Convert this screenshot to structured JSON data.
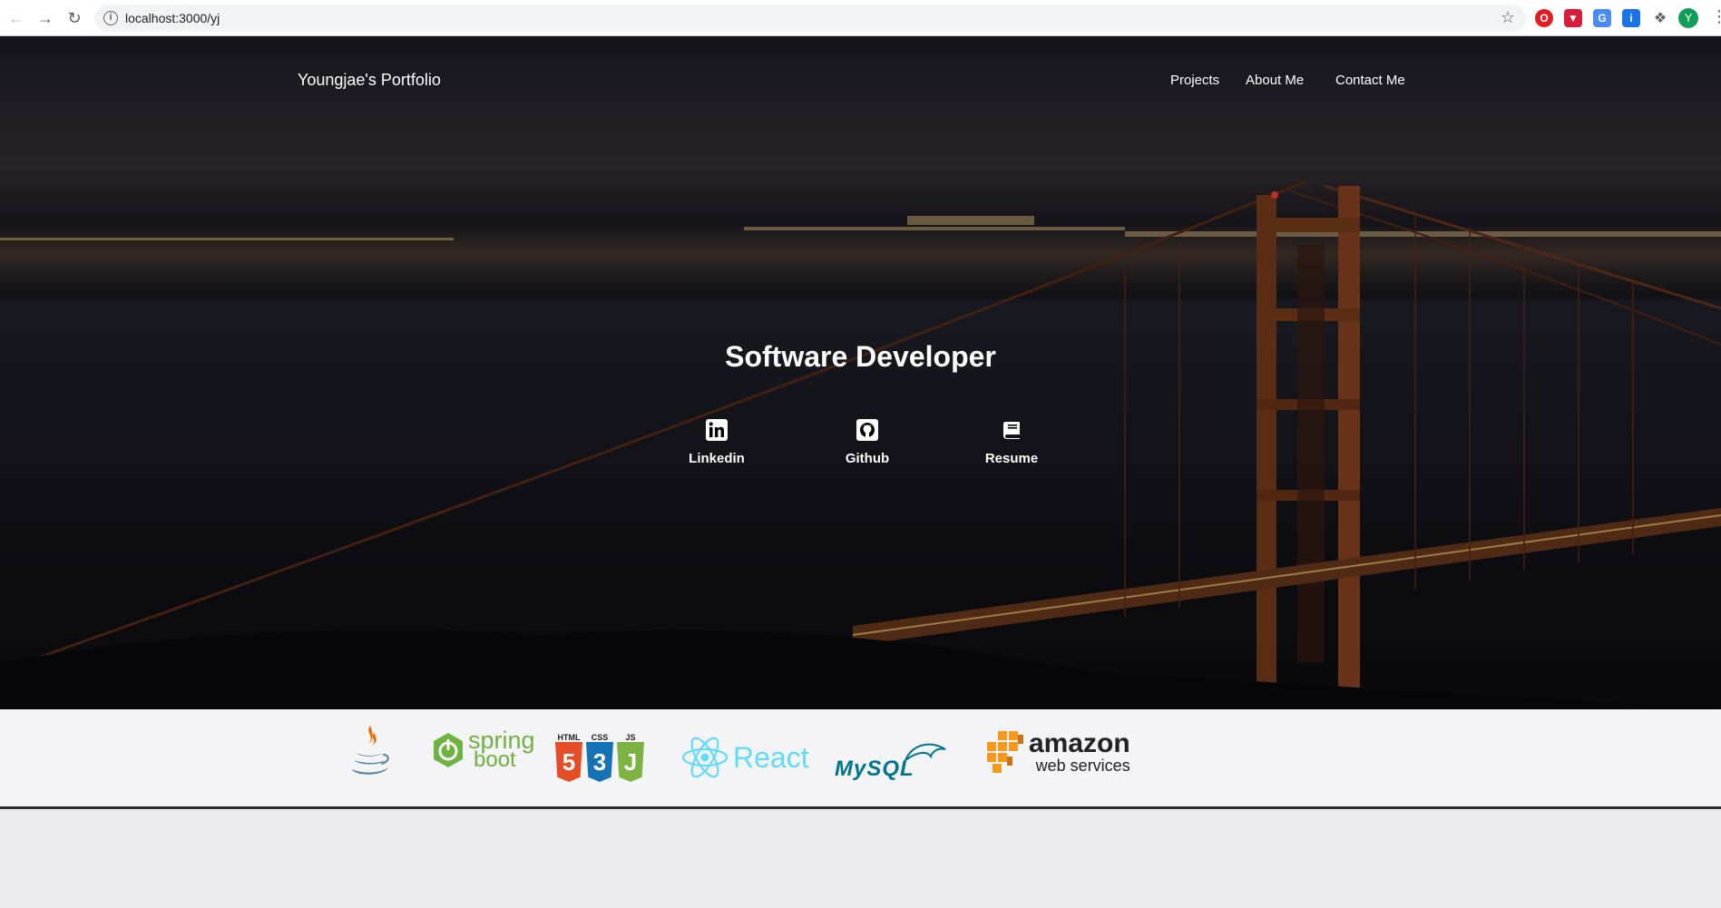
{
  "browser": {
    "url": "localhost:3000/yj",
    "profile_initial": "Y"
  },
  "nav": {
    "brand": "Youngjae's Portfolio",
    "links": [
      "Projects",
      "About Me",
      "Contact Me"
    ]
  },
  "hero": {
    "headline": "Software Developer",
    "social": [
      {
        "label": "Linkedin",
        "icon": "linkedin-icon"
      },
      {
        "label": "Github",
        "icon": "github-icon"
      },
      {
        "label": "Resume",
        "icon": "book-icon"
      }
    ]
  },
  "tech_stack": {
    "java": "java-logo",
    "spring_top": "spring",
    "spring_bottom": "boot",
    "html_label": "HTML",
    "css_label": "CSS",
    "js_label": "JS",
    "html_num": "5",
    "css_num": "3",
    "js_num": "J",
    "react": "React",
    "mysql": "MySQL",
    "aws_top": "amazon",
    "aws_bottom": "web services"
  },
  "colors": {
    "spring": "#6db33f",
    "html": "#e44d26",
    "css": "#1572b6",
    "js": "#7cb342",
    "react": "#61dafb",
    "mysql": "#00758f",
    "aws_orange": "#f7981d"
  }
}
